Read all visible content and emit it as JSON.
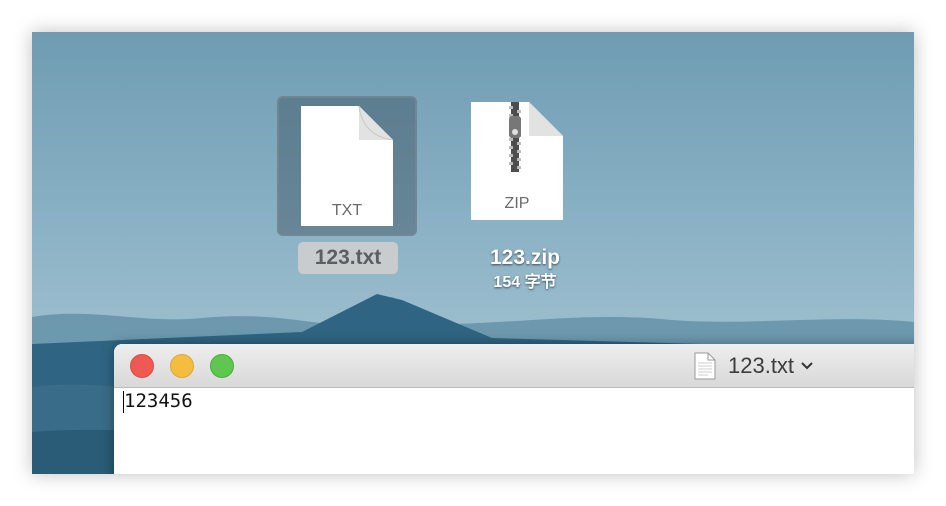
{
  "desktop": {
    "items": [
      {
        "name": "123.txt",
        "type_label": "TXT",
        "selected": true
      },
      {
        "name": "123.zip",
        "type_label": "ZIP",
        "size": "154 字节",
        "selected": false
      }
    ]
  },
  "window": {
    "title": "123.txt",
    "content": "123456"
  },
  "colors": {
    "close": "#ee5a53",
    "minimize": "#f5bd3f",
    "zoom": "#5fc64f",
    "selection": "#c9cccd"
  },
  "icons": [
    "txt-file-icon",
    "zip-file-icon",
    "document-icon",
    "chevron-down-icon"
  ]
}
